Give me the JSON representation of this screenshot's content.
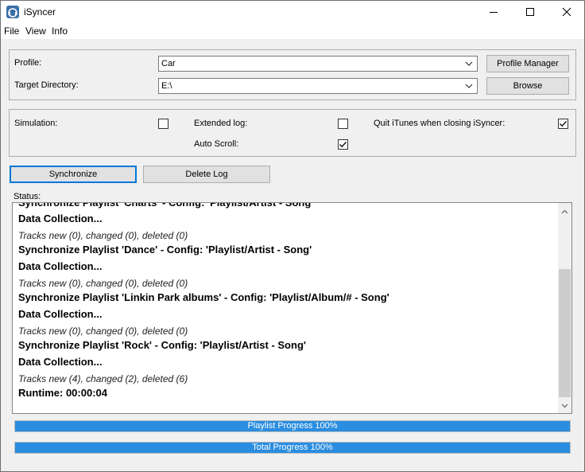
{
  "app": {
    "title": "iSyncer"
  },
  "menu": [
    "File",
    "View",
    "Info"
  ],
  "profile": {
    "label": "Profile:",
    "value": "Car",
    "manager_button": "Profile Manager"
  },
  "target": {
    "label": "Target Directory:",
    "value": "E:\\",
    "browse_button": "Browse"
  },
  "options": {
    "simulation": {
      "label": "Simulation:",
      "checked": false
    },
    "extended_log": {
      "label": "Extended log:",
      "checked": false
    },
    "quit_itunes": {
      "label": "Quit iTunes when closing iSyncer:",
      "checked": true
    },
    "auto_scroll": {
      "label": "Auto Scroll:",
      "checked": true
    }
  },
  "actions": {
    "synchronize": "Synchronize",
    "delete_log": "Delete Log"
  },
  "status": {
    "label": "Status:",
    "lines": [
      {
        "text": "Synchronize Playlist 'Charts' - Config: 'Playlist/Artist - Song'",
        "style": "bold"
      },
      {
        "text": "Data Collection...",
        "style": "bold"
      },
      {
        "text": "Tracks new (0), changed (0), deleted (0)",
        "style": "italic"
      },
      {
        "text": "Synchronize Playlist 'Dance' - Config: 'Playlist/Artist - Song'",
        "style": "bold"
      },
      {
        "text": "Data Collection...",
        "style": "bold"
      },
      {
        "text": "Tracks new (0), changed (0), deleted (0)",
        "style": "italic"
      },
      {
        "text": "Synchronize Playlist 'Linkin Park albums' - Config: 'Playlist/Album/# - Song'",
        "style": "bold"
      },
      {
        "text": "Data Collection...",
        "style": "bold"
      },
      {
        "text": "Tracks new (0), changed (0), deleted (0)",
        "style": "italic"
      },
      {
        "text": "Synchronize Playlist 'Rock' - Config: 'Playlist/Artist - Song'",
        "style": "bold"
      },
      {
        "text": "Data Collection...",
        "style": "bold"
      },
      {
        "text": "Tracks new (4), changed (2), deleted (6)",
        "style": "italic"
      },
      {
        "text": "Runtime: 00:00:04",
        "style": "bold"
      }
    ]
  },
  "progress": {
    "playlist": {
      "label": "Playlist Progress 100%",
      "value": 1.0
    },
    "total": {
      "label": "Total Progress 100%",
      "value": 1.0
    }
  },
  "colors": {
    "progress_fill": "#2a8de0",
    "focus_border": "#0078d7"
  }
}
